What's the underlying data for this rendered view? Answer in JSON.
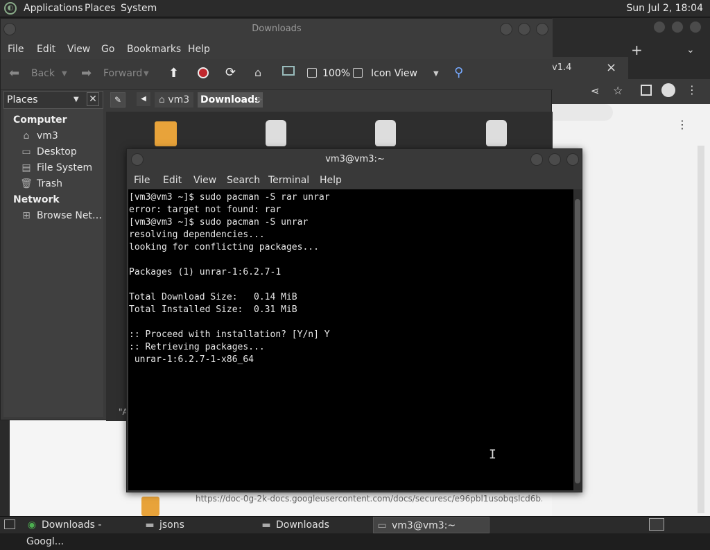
{
  "top_panel": {
    "menus": [
      "Applications",
      "Places",
      "System"
    ],
    "clock": "Sun Jul  2, 18:04"
  },
  "browser": {
    "tab_fragment": "v1.4",
    "tab_close": "×",
    "new_tab": "+",
    "more": "⋮"
  },
  "file_manager": {
    "title": "Downloads",
    "menu": [
      "File",
      "Edit",
      "View",
      "Go",
      "Bookmarks",
      "Help"
    ],
    "toolbar": {
      "back": "Back",
      "forward": "Forward",
      "zoom": "100%",
      "view_mode": "Icon View"
    },
    "sidebar": {
      "selector": "Places",
      "sections": [
        {
          "heading": "Computer",
          "items": [
            {
              "label": "vm3",
              "icon": "home-icon"
            },
            {
              "label": "Desktop",
              "icon": "desktop-icon"
            },
            {
              "label": "File System",
              "icon": "drive-icon"
            },
            {
              "label": "Trash",
              "icon": "trash-icon"
            }
          ]
        },
        {
          "heading": "Network",
          "items": [
            {
              "label": "Browse Net…",
              "icon": "network-icon"
            }
          ]
        }
      ]
    },
    "path": [
      "vm3",
      "Downloads"
    ],
    "status_fragment": "\"A"
  },
  "terminal": {
    "title": "vm3@vm3:~",
    "menu": [
      "File",
      "Edit",
      "View",
      "Search",
      "Terminal",
      "Help"
    ],
    "lines": [
      "[vm3@vm3 ~]$ sudo pacman -S rar unrar",
      "error: target not found: rar",
      "[vm3@vm3 ~]$ sudo pacman -S unrar",
      "resolving dependencies...",
      "looking for conflicting packages...",
      "",
      "Packages (1) unrar-1:6.2.7-1",
      "",
      "Total Download Size:   0.14 MiB",
      "Total Installed Size:  0.31 MiB",
      "",
      ":: Proceed with installation? [Y/n] Y",
      ":: Retrieving packages...",
      " unrar-1:6.2.7-1-x86_64"
    ]
  },
  "background_url": "https://doc-0g-2k-docs.googleusercontent.com/docs/securesc/e96pbl1usobqslcd6b...",
  "taskbar": {
    "tasks": [
      {
        "label": "Downloads - Googl...",
        "icon": "chrome-icon"
      },
      {
        "label": "jsons",
        "icon": "folder-icon"
      },
      {
        "label": "Downloads",
        "icon": "folder-icon"
      },
      {
        "label": "vm3@vm3:~",
        "icon": "terminal-icon"
      }
    ]
  }
}
